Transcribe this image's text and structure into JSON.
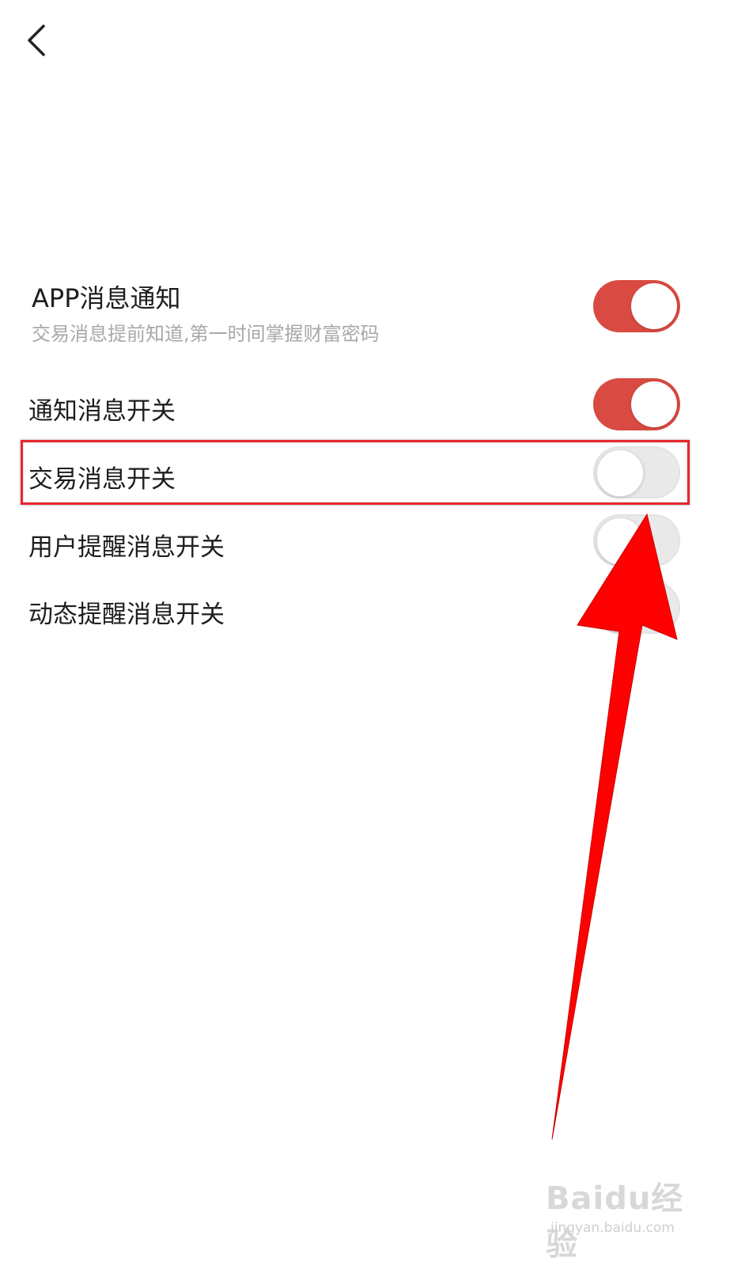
{
  "nav": {
    "back_icon": "chevron-left-icon"
  },
  "settings": [
    {
      "label": "APP消息通知",
      "sublabel": "交易消息提前知道,第一时间掌握财富密码",
      "enabled": true
    },
    {
      "label": "通知消息开关",
      "enabled": true
    },
    {
      "label": "交易消息开关",
      "enabled": false,
      "highlighted": true
    },
    {
      "label": "用户提醒消息开关",
      "enabled": false
    },
    {
      "label": "动态提醒消息开关",
      "enabled": false
    }
  ],
  "colors": {
    "toggle_on": "#d84a42",
    "toggle_off": "#e9e9e9",
    "annotation": "#ff0000"
  },
  "watermark": {
    "logo": "Baidu经验",
    "url": "jingyan.baidu.com"
  }
}
